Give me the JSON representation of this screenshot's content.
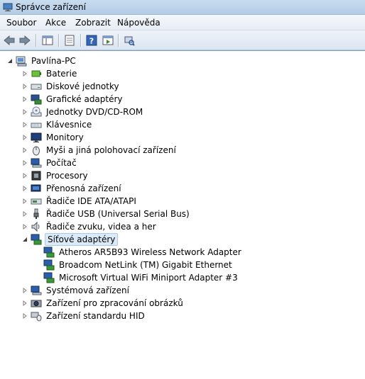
{
  "window": {
    "title": "Správce zařízení"
  },
  "menu": [
    "Soubor",
    "Akce",
    "Zobrazit",
    "Nápověda"
  ],
  "toolbar": {
    "icons": [
      "back-arrow-icon",
      "forward-arrow-icon",
      "console-tree-icon",
      "properties-icon",
      "help-icon",
      "action-pane-icon",
      "scan-hardware-icon"
    ]
  },
  "tree": {
    "root": "Pavlína-PC",
    "categories": [
      {
        "label": "Baterie",
        "icon": "battery-icon",
        "expanded": false
      },
      {
        "label": "Diskové jednotky",
        "icon": "disk-drive-icon",
        "expanded": false
      },
      {
        "label": "Grafické adaptéry",
        "icon": "display-adapter-icon",
        "expanded": false
      },
      {
        "label": "Jednotky DVD/CD-ROM",
        "icon": "dvd-drive-icon",
        "expanded": false
      },
      {
        "label": "Klávesnice",
        "icon": "keyboard-icon",
        "expanded": false
      },
      {
        "label": "Monitory",
        "icon": "monitor-icon",
        "expanded": false
      },
      {
        "label": "Myši a jiná polohovací zařízení",
        "icon": "mouse-icon",
        "expanded": false
      },
      {
        "label": "Počítač",
        "icon": "computer-icon",
        "expanded": false
      },
      {
        "label": "Procesory",
        "icon": "processor-icon",
        "expanded": false
      },
      {
        "label": "Přenosná zařízení",
        "icon": "portable-device-icon",
        "expanded": false
      },
      {
        "label": "Řadiče IDE ATA/ATAPI",
        "icon": "ide-controller-icon",
        "expanded": false
      },
      {
        "label": "Řadiče USB (Universal Serial Bus)",
        "icon": "usb-controller-icon",
        "expanded": false
      },
      {
        "label": "Řadiče zvuku, videa a her",
        "icon": "sound-icon",
        "expanded": false
      },
      {
        "label": "Síťové adaptéry",
        "icon": "network-adapter-icon",
        "expanded": true,
        "selected": true,
        "children": [
          "Atheros AR5B93 Wireless Network Adapter",
          "Broadcom NetLink (TM) Gigabit Ethernet",
          "Microsoft Virtual WiFi Miniport Adapter #3"
        ]
      },
      {
        "label": "Systémová zařízení",
        "icon": "system-device-icon",
        "expanded": false
      },
      {
        "label": "Zařízení pro zpracování obrázků",
        "icon": "imaging-device-icon",
        "expanded": false
      },
      {
        "label": "Zařízení standardu HID",
        "icon": "hid-device-icon",
        "expanded": false
      }
    ]
  },
  "colors": {
    "selection_bg": "#dbeaf9",
    "selection_border": "#a8c8ec",
    "titlebar": "#c0d6ec"
  }
}
